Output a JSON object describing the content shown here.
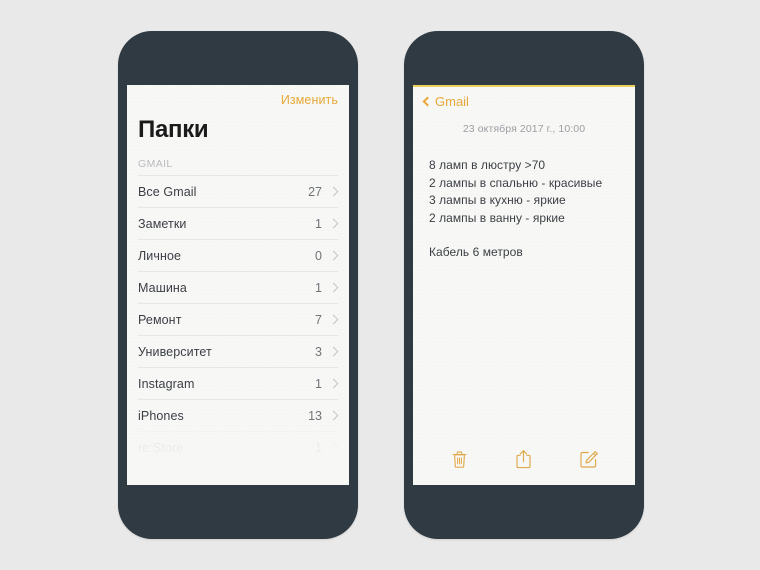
{
  "canvas": {
    "background_color": "#e9e9e9",
    "accent_color": "#e8a93a",
    "frame_color": "#2f3a42",
    "screen_color": "#f7f7f5",
    "top_rule_color": "#e8d25a"
  },
  "left_phone": {
    "edit_label": "Изменить",
    "page_title": "Папки",
    "section_label": "GMAIL",
    "folders": [
      {
        "name": "Все Gmail",
        "count": "27"
      },
      {
        "name": "Заметки",
        "count": "1"
      },
      {
        "name": "Личное",
        "count": "0"
      },
      {
        "name": "Машина",
        "count": "1"
      },
      {
        "name": "Ремонт",
        "count": "7"
      },
      {
        "name": "Университет",
        "count": "3"
      },
      {
        "name": "Instagram",
        "count": "1"
      },
      {
        "name": "iPhones",
        "count": "13"
      },
      {
        "name": "re:Store",
        "count": "1"
      }
    ]
  },
  "right_phone": {
    "back_label": "Gmail",
    "date": "23 октября 2017 г., 10:00",
    "note_lines": [
      "8 ламп в люстру >70",
      "2 лампы в спальню - красивые",
      "3 лампы в кухню - яркие",
      "2 лампы в ванну - яркие"
    ],
    "note_lines_second": [
      "Кабель 6 метров"
    ],
    "toolbar": [
      {
        "icon": "trash-icon"
      },
      {
        "icon": "share-icon"
      },
      {
        "icon": "compose-icon"
      }
    ]
  }
}
